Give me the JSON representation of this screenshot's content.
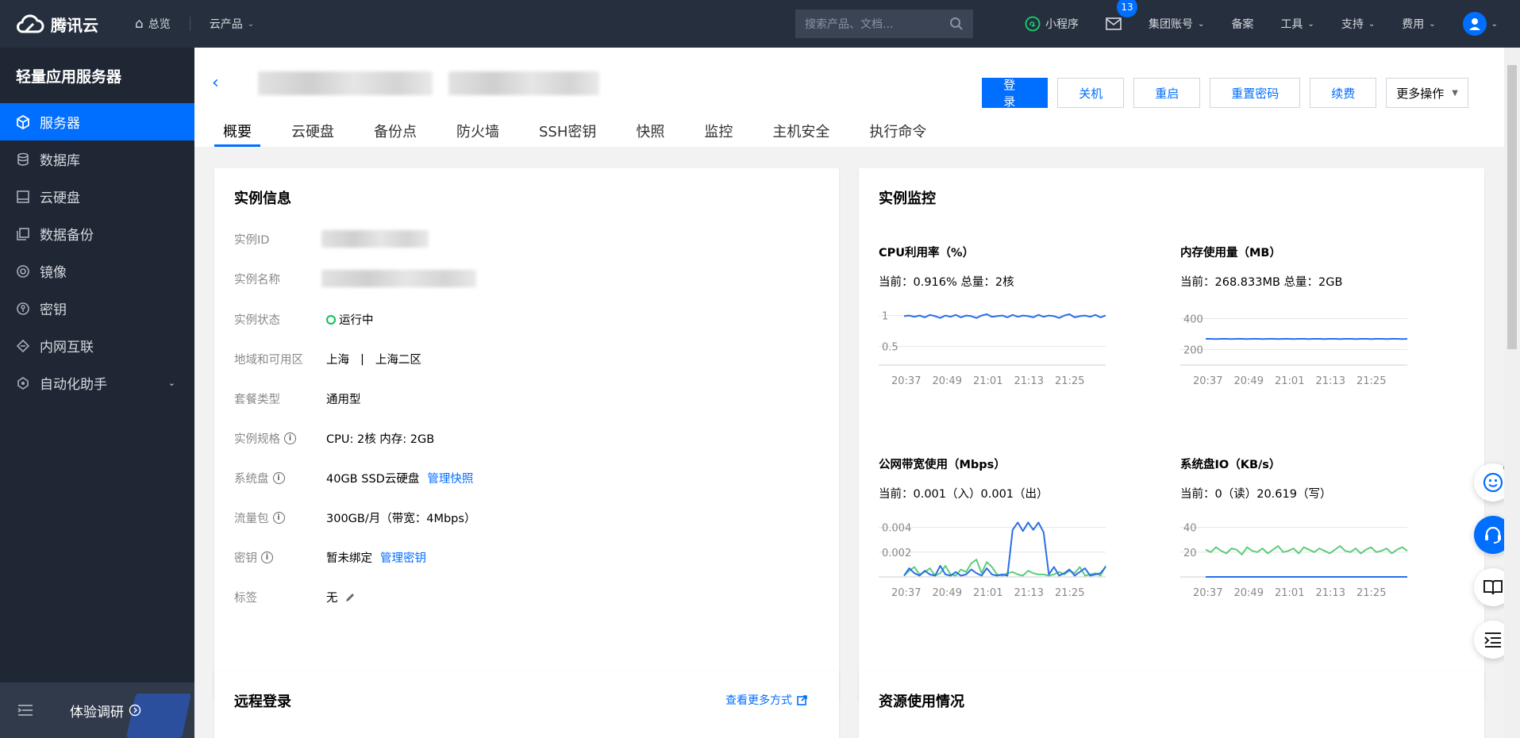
{
  "topbar": {
    "brand": "腾讯云",
    "nav_home": "总览",
    "nav_products": "云产品",
    "search_placeholder": "搜索产品、文档...",
    "mini_program": "小程序",
    "mail_badge": "13",
    "group_account": "集团账号",
    "beian": "备案",
    "tools": "工具",
    "support": "支持",
    "billing": "费用"
  },
  "sidebar": {
    "title": "轻量应用服务器",
    "items": [
      {
        "label": "服务器",
        "icon": "cube-icon"
      },
      {
        "label": "数据库",
        "icon": "database-icon"
      },
      {
        "label": "云硬盘",
        "icon": "disk-icon"
      },
      {
        "label": "数据备份",
        "icon": "backup-icon"
      },
      {
        "label": "镜像",
        "icon": "image-icon"
      },
      {
        "label": "密钥",
        "icon": "key-icon"
      },
      {
        "label": "内网互联",
        "icon": "network-icon"
      },
      {
        "label": "自动化助手",
        "icon": "robot-icon"
      }
    ],
    "survey": "体验调研"
  },
  "header": {
    "actions": {
      "login": "登录",
      "shutdown": "关机",
      "restart": "重启",
      "reset_password": "重置密码",
      "renew": "续费",
      "more": "更多操作"
    },
    "tabs": [
      "概要",
      "云硬盘",
      "备份点",
      "防火墙",
      "SSH密钥",
      "快照",
      "监控",
      "主机安全",
      "执行命令"
    ]
  },
  "instance_info": {
    "title": "实例信息",
    "labels": {
      "id": "实例ID",
      "name": "实例名称",
      "status": "实例状态",
      "region": "地域和可用区",
      "plan": "套餐类型",
      "spec": "实例规格",
      "system_disk": "系统盘",
      "traffic": "流量包",
      "key": "密钥",
      "tags": "标签"
    },
    "values": {
      "status": "运行中",
      "region": "上海",
      "region_sep": "|",
      "zone": "上海二区",
      "plan": "通用型",
      "spec": "CPU: 2核 内存: 2GB",
      "system_disk": "40GB SSD云硬盘",
      "system_disk_link": "管理快照",
      "traffic": "300GB/月（带宽：4Mbps）",
      "key": "暂未绑定",
      "key_link": "管理密钥",
      "tags": "无"
    }
  },
  "monitor": {
    "title": "实例监控",
    "x_ticks": [
      "20:37",
      "20:49",
      "21:01",
      "21:13",
      "21:25"
    ],
    "charts": [
      {
        "title": "CPU利用率（%）",
        "current": "当前：0.916% 总量：2核",
        "y_ticks": [
          "1",
          "0.5"
        ]
      },
      {
        "title": "内存使用量（MB）",
        "current": "当前：268.833MB 总量：2GB",
        "y_ticks": [
          "400",
          "200"
        ]
      },
      {
        "title": "公网带宽使用（Mbps）",
        "current": "当前：0.001（入）0.001（出）",
        "y_ticks": [
          "0.004",
          "0.002"
        ]
      },
      {
        "title": "系统盘IO（KB/s）",
        "current": "当前：0（读）20.619（写）",
        "y_ticks": [
          "40",
          "20"
        ]
      }
    ]
  },
  "remote_login": {
    "title": "远程登录",
    "more_link": "查看更多方式"
  },
  "resource_usage": {
    "title": "资源使用情况"
  },
  "chart_data": [
    {
      "type": "line",
      "title": "CPU利用率（%）",
      "y_range": [
        0.2,
        1.2
      ],
      "series": [
        {
          "color": "#2a6ee8",
          "values": [
            0.99,
            1.0,
            0.98,
            1.0,
            0.97,
            1.01,
            0.99,
            0.96,
            1.0,
            0.98,
            1.01,
            0.97,
            1.0,
            0.99,
            0.96,
            1.0,
            1.02,
            0.98,
            0.99,
            1.0,
            0.97,
            1.01,
            0.98,
            1.0,
            0.99,
            0.97,
            1.01,
            0.98,
            1.0,
            0.99,
            0.96,
            1.0,
            1.02,
            0.97,
            0.99,
            1.0,
            0.98,
            1.01,
            0.97,
            1.0
          ]
        }
      ]
    },
    {
      "type": "line",
      "title": "内存使用量（MB）",
      "y_range": [
        100,
        500
      ],
      "series": [
        {
          "color": "#2a6ee8",
          "values": [
            269,
            269,
            268,
            269,
            269,
            268,
            269,
            269,
            268,
            269,
            269,
            268,
            269,
            269,
            268,
            269,
            269,
            268,
            269,
            269,
            268,
            269,
            269,
            268,
            269,
            269,
            268,
            269,
            269,
            268,
            269,
            269,
            268,
            269,
            269,
            268,
            269,
            269,
            268,
            269
          ]
        }
      ]
    },
    {
      "type": "line",
      "title": "公网带宽使用（Mbps）",
      "y_range": [
        0,
        0.005
      ],
      "series": [
        {
          "name": "入",
          "color": "#5ccd7a",
          "values": [
            0.0001,
            0.0005,
            0.0008,
            0.0002,
            0.0004,
            0.0007,
            0.0001,
            0.0003,
            0.0009,
            0.0002,
            0.0001,
            0.0006,
            0.0004,
            0.0011,
            0.0014,
            0.0003,
            0.0012,
            0.0008,
            0.0002,
            0.0001,
            0.0003,
            0.0004,
            0.0002,
            0.0001,
            0.0005,
            0.0003,
            0.0002,
            0.0002,
            0.0001,
            0.0002,
            0.0004,
            0.0002,
            0.0005,
            0.0003,
            0.0008,
            0.0001,
            0.0002,
            0.0003,
            0.0001,
            0.0009
          ]
        },
        {
          "name": "出",
          "color": "#2a6ee8",
          "values": [
            0.0001,
            0.0007,
            0.0003,
            0.0001,
            0.0005,
            0.0002,
            0.0001,
            0.0009,
            0.0002,
            0.0001,
            0.0004,
            0.0001,
            0.0002,
            0.0006,
            0.0003,
            0.0001,
            0.0007,
            0.0002,
            0.0001,
            0.0002,
            0.0001,
            0.0038,
            0.0044,
            0.0037,
            0.0044,
            0.0038,
            0.0044,
            0.0036,
            0.0002,
            0.0008,
            0.0001,
            0.0003,
            0.0006,
            0.0001,
            0.0004,
            0.0007,
            0.0001,
            0.0002,
            0.0003,
            0.0008
          ]
        }
      ]
    },
    {
      "type": "line",
      "title": "系统盘IO（KB/s）",
      "y_range": [
        0,
        50
      ],
      "series": [
        {
          "name": "写",
          "color": "#5ccd7a",
          "values": [
            22,
            20,
            24,
            21,
            19,
            23,
            22,
            18,
            24,
            21,
            20,
            23,
            19,
            22,
            25,
            20,
            21,
            23,
            19,
            24,
            22,
            20,
            23,
            21,
            19,
            22,
            25,
            21,
            20,
            23,
            19,
            22,
            24,
            20,
            21,
            23,
            19,
            22,
            24,
            21
          ]
        },
        {
          "name": "读",
          "color": "#2a6ee8",
          "values": [
            0,
            0,
            0,
            0,
            0,
            0,
            0,
            0,
            0,
            0,
            0,
            0,
            0,
            0,
            0,
            0,
            0,
            0,
            0,
            0,
            0,
            0,
            0,
            0,
            0,
            0,
            0,
            0,
            0,
            0,
            0,
            0,
            0,
            0,
            0,
            0,
            0,
            0,
            0,
            0
          ]
        }
      ]
    }
  ]
}
